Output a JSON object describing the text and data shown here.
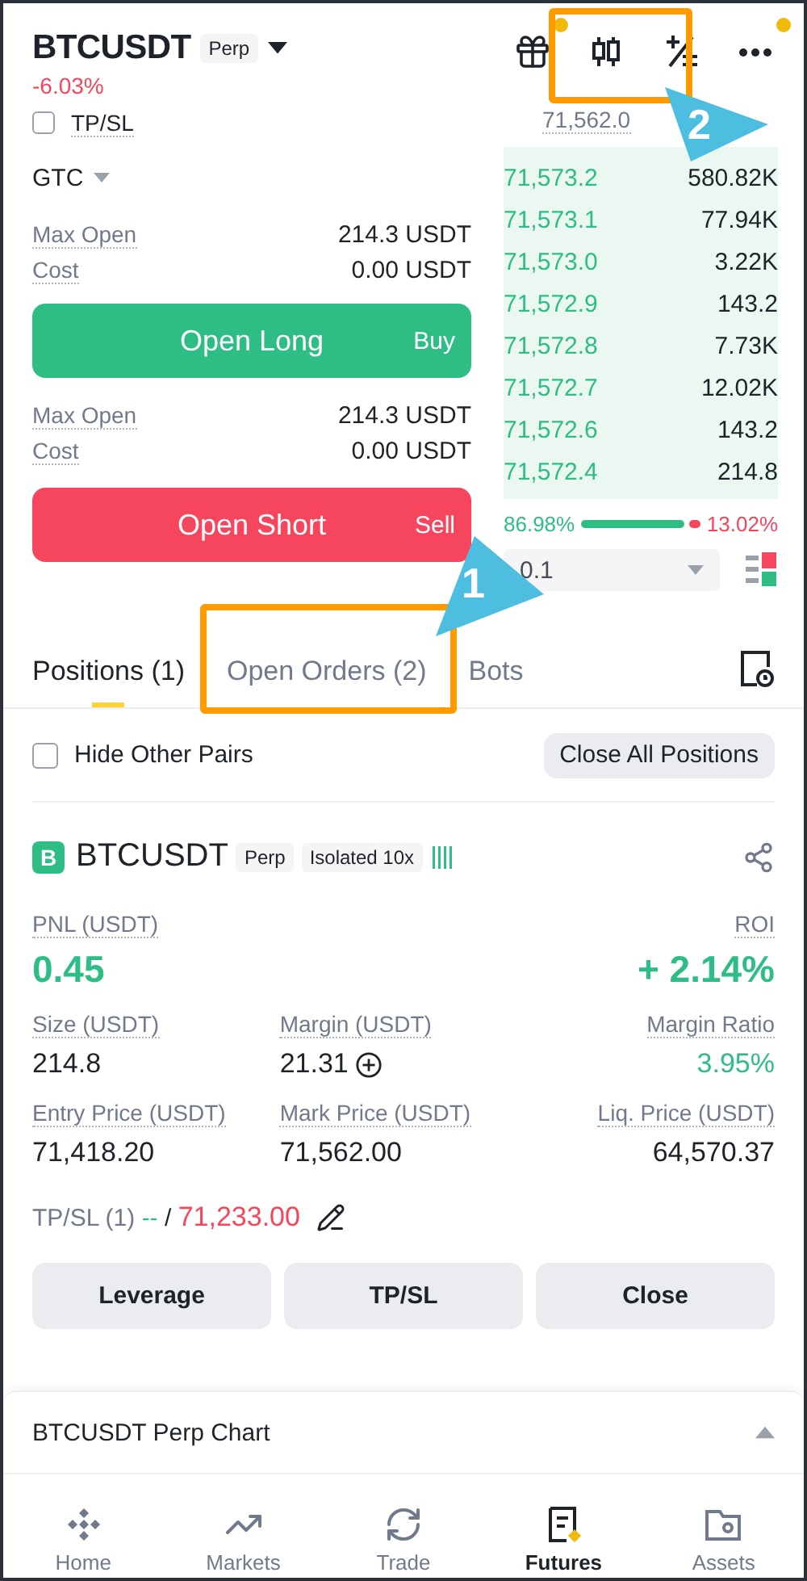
{
  "header": {
    "symbol": "BTCUSDT",
    "badge": "Perp",
    "change": "-6.03%",
    "notification_dots": [
      true,
      true
    ]
  },
  "order_form": {
    "tp_sl": {
      "label": "TP/SL",
      "checked": false
    },
    "order_type": "GTC",
    "mark_price": "71,562.0",
    "long": {
      "rows": [
        {
          "label": "Max Open",
          "value": "214.3 USDT"
        },
        {
          "label": "Cost",
          "value": "0.00 USDT"
        }
      ],
      "button": "Open Long",
      "side": "Buy"
    },
    "short": {
      "rows": [
        {
          "label": "Max Open",
          "value": "214.3 USDT"
        },
        {
          "label": "Cost",
          "value": "0.00 USDT"
        }
      ],
      "button": "Open Short",
      "side": "Sell"
    }
  },
  "order_book": {
    "rows": [
      {
        "price": "71,573.2",
        "size": "580.82K"
      },
      {
        "price": "71,573.1",
        "size": "77.94K"
      },
      {
        "price": "71,573.0",
        "size": "3.22K"
      },
      {
        "price": "71,572.9",
        "size": "143.2"
      },
      {
        "price": "71,572.8",
        "size": "7.73K"
      },
      {
        "price": "71,572.7",
        "size": "12.02K"
      },
      {
        "price": "71,572.6",
        "size": "143.2"
      },
      {
        "price": "71,572.4",
        "size": "214.8"
      }
    ],
    "buy_ratio": "86.98%",
    "sell_ratio": "13.02%",
    "level": 0.87,
    "precision": "0.1"
  },
  "tabs": [
    {
      "label": "Positions (1)",
      "selected": true
    },
    {
      "label": "Open Orders (2)",
      "selected": false
    },
    {
      "label": "Bots",
      "selected": false
    }
  ],
  "filter": {
    "label": "Hide Other Pairs",
    "checked": false
  },
  "close_all": "Close All Positions",
  "position": {
    "side": "B",
    "symbol": "BTCUSDT",
    "tags": [
      "Perp",
      "Isolated 10x"
    ],
    "pnl_label": "PNL (USDT)",
    "pnl": "0.45",
    "roi_label": "ROI",
    "roi": "+ 2.14%",
    "stats": [
      {
        "label": "Size (USDT)",
        "value": "214.8"
      },
      {
        "label": "Margin (USDT)",
        "value": "21.31"
      },
      {
        "label": "Margin Ratio",
        "value": "3.95%",
        "color": "#2ebd85"
      },
      {
        "label": "Entry Price (USDT)",
        "value": "71,418.20"
      },
      {
        "label": "Mark Price (USDT)",
        "value": "71,562.00"
      },
      {
        "label": "Liq. Price (USDT)",
        "value": "64,570.37"
      }
    ],
    "tpsl_label": "TP/SL (1)",
    "tp": "--",
    "separator": "/",
    "sl": "71,233.00",
    "actions": [
      "Leverage",
      "TP/SL",
      "Close"
    ]
  },
  "chart_bar": {
    "title": "BTCUSDT Perp Chart",
    "expanded": false
  },
  "nav": [
    {
      "label": "Home",
      "selected": false
    },
    {
      "label": "Markets",
      "selected": false
    },
    {
      "label": "Trade",
      "selected": false
    },
    {
      "label": "Futures",
      "selected": true
    },
    {
      "label": "Assets",
      "selected": false
    }
  ],
  "annotations": [
    {
      "number": "1"
    },
    {
      "number": "2"
    }
  ]
}
